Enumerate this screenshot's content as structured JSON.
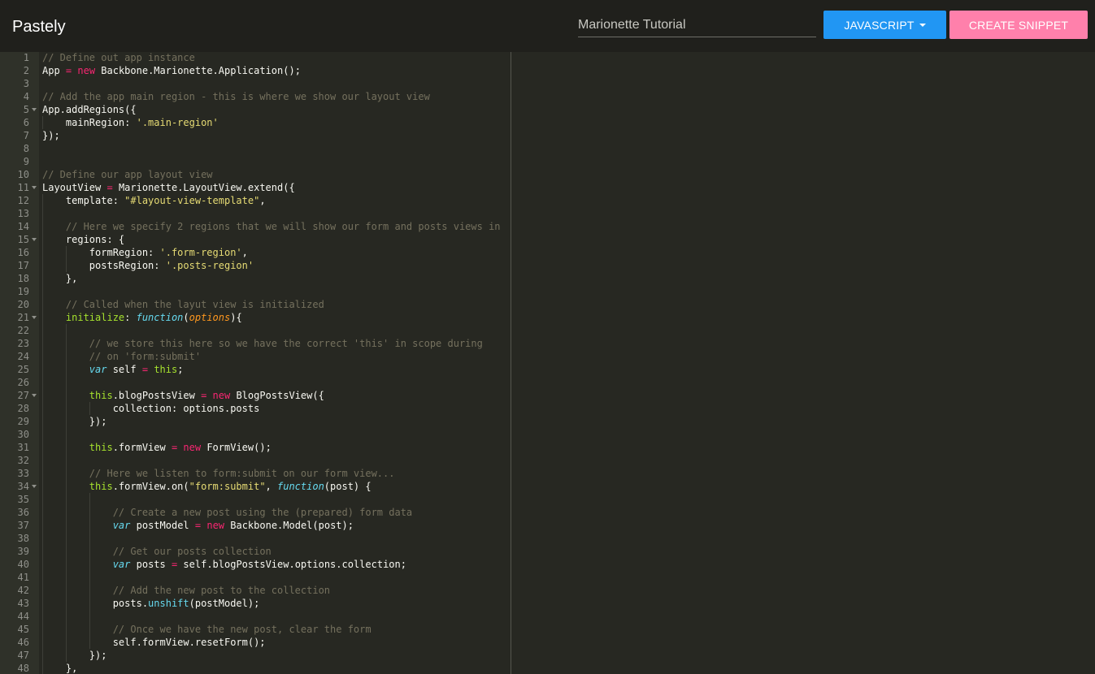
{
  "app": {
    "brand": "Pastely"
  },
  "header": {
    "title_value": "Marionette Tutorial",
    "language_button": "JAVASCRIPT",
    "create_button": "CREATE SNIPPET"
  },
  "colors": {
    "background": "#272822",
    "topbar": "#20201c",
    "gutter": "#2f3129",
    "language_button": "#2196f3",
    "create_button": "#ff80ab"
  },
  "icons": {
    "language_dropdown": "caret-down-icon",
    "fold": "fold-arrow-icon"
  },
  "editor": {
    "theme": {
      "comment": "#75715e",
      "keyword": "#f92672",
      "string": "#e6db74",
      "storage": "#66d9ef",
      "this": "#a6e22e",
      "method": "#66d9ef",
      "param": "#fd971f",
      "plain": "#f8f8f2"
    },
    "lines": [
      {
        "n": "1",
        "fold": false,
        "indent": 0,
        "tokens": [
          [
            "// Define out app instance",
            "comment"
          ]
        ]
      },
      {
        "n": "2",
        "fold": false,
        "indent": 0,
        "tokens": [
          [
            "App ",
            "plain"
          ],
          [
            "=",
            "keyword"
          ],
          [
            " ",
            "plain"
          ],
          [
            "new",
            "keyword"
          ],
          [
            " Backbone.Marionette.Application();",
            "plain"
          ]
        ]
      },
      {
        "n": "3",
        "fold": false,
        "indent": 0,
        "tokens": []
      },
      {
        "n": "4",
        "fold": false,
        "indent": 0,
        "tokens": [
          [
            "// Add the app main region - this is where we show our layout view",
            "comment"
          ]
        ]
      },
      {
        "n": "5",
        "fold": true,
        "indent": 0,
        "tokens": [
          [
            "App.addRegions({",
            "plain"
          ]
        ]
      },
      {
        "n": "6",
        "fold": false,
        "indent": 1,
        "tokens": [
          [
            "    mainRegion: ",
            "plain"
          ],
          [
            "'.main-region'",
            "string"
          ]
        ]
      },
      {
        "n": "7",
        "fold": false,
        "indent": 0,
        "tokens": [
          [
            "});",
            "plain"
          ]
        ]
      },
      {
        "n": "8",
        "fold": false,
        "indent": 0,
        "tokens": []
      },
      {
        "n": "9",
        "fold": false,
        "indent": 0,
        "tokens": []
      },
      {
        "n": "10",
        "fold": false,
        "indent": 0,
        "tokens": [
          [
            "// Define our app layout view",
            "comment"
          ]
        ]
      },
      {
        "n": "11",
        "fold": true,
        "indent": 0,
        "tokens": [
          [
            "LayoutView ",
            "plain"
          ],
          [
            "=",
            "keyword"
          ],
          [
            " Marionette.LayoutView.extend({",
            "plain"
          ]
        ]
      },
      {
        "n": "12",
        "fold": false,
        "indent": 1,
        "tokens": [
          [
            "    template: ",
            "plain"
          ],
          [
            "\"#layout-view-template\"",
            "string"
          ],
          [
            ",",
            "plain"
          ]
        ]
      },
      {
        "n": "13",
        "fold": false,
        "indent": 1,
        "tokens": []
      },
      {
        "n": "14",
        "fold": false,
        "indent": 1,
        "tokens": [
          [
            "    ",
            "plain"
          ],
          [
            "// Here we specify 2 regions that we will show our form and posts views in",
            "comment"
          ]
        ]
      },
      {
        "n": "15",
        "fold": true,
        "indent": 1,
        "tokens": [
          [
            "    regions: {",
            "plain"
          ]
        ]
      },
      {
        "n": "16",
        "fold": false,
        "indent": 2,
        "tokens": [
          [
            "        formRegion: ",
            "plain"
          ],
          [
            "'.form-region'",
            "string"
          ],
          [
            ",",
            "plain"
          ]
        ]
      },
      {
        "n": "17",
        "fold": false,
        "indent": 2,
        "tokens": [
          [
            "        postsRegion: ",
            "plain"
          ],
          [
            "'.posts-region'",
            "string"
          ]
        ]
      },
      {
        "n": "18",
        "fold": false,
        "indent": 1,
        "tokens": [
          [
            "    },",
            "plain"
          ]
        ]
      },
      {
        "n": "19",
        "fold": false,
        "indent": 1,
        "tokens": []
      },
      {
        "n": "20",
        "fold": false,
        "indent": 1,
        "tokens": [
          [
            "    ",
            "plain"
          ],
          [
            "// Called when the layut view is initialized",
            "comment"
          ]
        ]
      },
      {
        "n": "21",
        "fold": true,
        "indent": 1,
        "tokens": [
          [
            "    ",
            "plain"
          ],
          [
            "initialize",
            "this"
          ],
          [
            ": ",
            "plain"
          ],
          [
            "function",
            "storage"
          ],
          [
            "(",
            "plain"
          ],
          [
            "options",
            "param"
          ],
          [
            "){",
            "plain"
          ]
        ]
      },
      {
        "n": "22",
        "fold": false,
        "indent": 2,
        "tokens": []
      },
      {
        "n": "23",
        "fold": false,
        "indent": 2,
        "tokens": [
          [
            "        ",
            "plain"
          ],
          [
            "// we store this here so we have the correct 'this' in scope during",
            "comment"
          ]
        ]
      },
      {
        "n": "24",
        "fold": false,
        "indent": 2,
        "tokens": [
          [
            "        ",
            "plain"
          ],
          [
            "// on 'form:submit'",
            "comment"
          ]
        ]
      },
      {
        "n": "25",
        "fold": false,
        "indent": 2,
        "tokens": [
          [
            "        ",
            "plain"
          ],
          [
            "var",
            "storage"
          ],
          [
            " self ",
            "plain"
          ],
          [
            "=",
            "keyword"
          ],
          [
            " ",
            "plain"
          ],
          [
            "this",
            "this"
          ],
          [
            ";",
            "plain"
          ]
        ]
      },
      {
        "n": "26",
        "fold": false,
        "indent": 2,
        "tokens": []
      },
      {
        "n": "27",
        "fold": true,
        "indent": 2,
        "tokens": [
          [
            "        ",
            "plain"
          ],
          [
            "this",
            "this"
          ],
          [
            ".blogPostsView ",
            "plain"
          ],
          [
            "=",
            "keyword"
          ],
          [
            " ",
            "plain"
          ],
          [
            "new",
            "keyword"
          ],
          [
            " BlogPostsView({",
            "plain"
          ]
        ]
      },
      {
        "n": "28",
        "fold": false,
        "indent": 3,
        "tokens": [
          [
            "            collection: options.posts",
            "plain"
          ]
        ]
      },
      {
        "n": "29",
        "fold": false,
        "indent": 2,
        "tokens": [
          [
            "        });",
            "plain"
          ]
        ]
      },
      {
        "n": "30",
        "fold": false,
        "indent": 2,
        "tokens": []
      },
      {
        "n": "31",
        "fold": false,
        "indent": 2,
        "tokens": [
          [
            "        ",
            "plain"
          ],
          [
            "this",
            "this"
          ],
          [
            ".formView ",
            "plain"
          ],
          [
            "=",
            "keyword"
          ],
          [
            " ",
            "plain"
          ],
          [
            "new",
            "keyword"
          ],
          [
            " FormView();",
            "plain"
          ]
        ]
      },
      {
        "n": "32",
        "fold": false,
        "indent": 2,
        "tokens": []
      },
      {
        "n": "33",
        "fold": false,
        "indent": 2,
        "tokens": [
          [
            "        ",
            "plain"
          ],
          [
            "// Here we listen to form:submit on our form view...",
            "comment"
          ]
        ]
      },
      {
        "n": "34",
        "fold": true,
        "indent": 2,
        "tokens": [
          [
            "        ",
            "plain"
          ],
          [
            "this",
            "this"
          ],
          [
            ".formView.on(",
            "plain"
          ],
          [
            "\"form:submit\"",
            "string"
          ],
          [
            ", ",
            "plain"
          ],
          [
            "function",
            "storage"
          ],
          [
            "(post) {",
            "plain"
          ]
        ]
      },
      {
        "n": "35",
        "fold": false,
        "indent": 3,
        "tokens": []
      },
      {
        "n": "36",
        "fold": false,
        "indent": 3,
        "tokens": [
          [
            "            ",
            "plain"
          ],
          [
            "// Create a new post using the (prepared) form data",
            "comment"
          ]
        ]
      },
      {
        "n": "37",
        "fold": false,
        "indent": 3,
        "tokens": [
          [
            "            ",
            "plain"
          ],
          [
            "var",
            "storage"
          ],
          [
            " postModel ",
            "plain"
          ],
          [
            "=",
            "keyword"
          ],
          [
            " ",
            "plain"
          ],
          [
            "new",
            "keyword"
          ],
          [
            " Backbone.Model(post);",
            "plain"
          ]
        ]
      },
      {
        "n": "38",
        "fold": false,
        "indent": 3,
        "tokens": []
      },
      {
        "n": "39",
        "fold": false,
        "indent": 3,
        "tokens": [
          [
            "            ",
            "plain"
          ],
          [
            "// Get our posts collection",
            "comment"
          ]
        ]
      },
      {
        "n": "40",
        "fold": false,
        "indent": 3,
        "tokens": [
          [
            "            ",
            "plain"
          ],
          [
            "var",
            "storage"
          ],
          [
            " posts ",
            "plain"
          ],
          [
            "=",
            "keyword"
          ],
          [
            " self.blogPostsView.options.collection;",
            "plain"
          ]
        ]
      },
      {
        "n": "41",
        "fold": false,
        "indent": 3,
        "tokens": []
      },
      {
        "n": "42",
        "fold": false,
        "indent": 3,
        "tokens": [
          [
            "            ",
            "plain"
          ],
          [
            "// Add the new post to the collection",
            "comment"
          ]
        ]
      },
      {
        "n": "43",
        "fold": false,
        "indent": 3,
        "tokens": [
          [
            "            posts.",
            "plain"
          ],
          [
            "unshift",
            "method"
          ],
          [
            "(postModel);",
            "plain"
          ]
        ]
      },
      {
        "n": "44",
        "fold": false,
        "indent": 3,
        "tokens": []
      },
      {
        "n": "45",
        "fold": false,
        "indent": 3,
        "tokens": [
          [
            "            ",
            "plain"
          ],
          [
            "// Once we have the new post, clear the form",
            "comment"
          ]
        ]
      },
      {
        "n": "46",
        "fold": false,
        "indent": 3,
        "tokens": [
          [
            "            self.formView.resetForm();",
            "plain"
          ]
        ]
      },
      {
        "n": "47",
        "fold": false,
        "indent": 2,
        "tokens": [
          [
            "        });",
            "plain"
          ]
        ]
      },
      {
        "n": "48",
        "fold": false,
        "indent": 1,
        "tokens": [
          [
            "    },",
            "plain"
          ]
        ]
      }
    ]
  }
}
